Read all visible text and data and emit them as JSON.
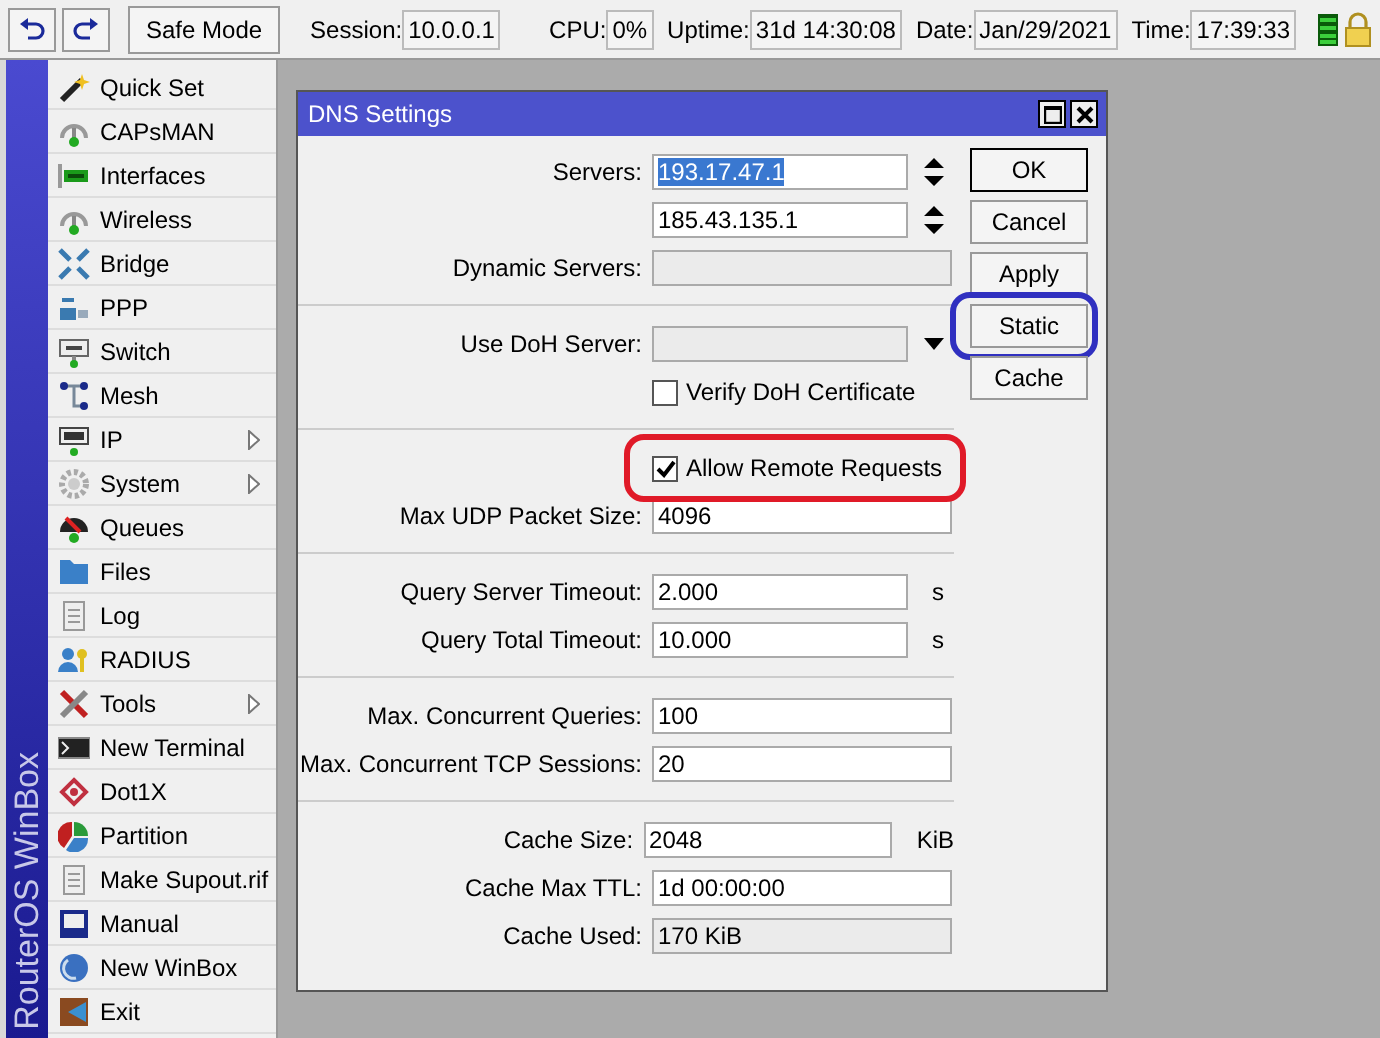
{
  "toolbar": {
    "safe_mode": "Safe Mode",
    "session_label": "Session:",
    "session": "10.0.0.1",
    "status": [
      {
        "label": "CPU:",
        "value": "0%"
      },
      {
        "label": "Uptime:",
        "value": "31d 14:30:08"
      },
      {
        "label": "Date:",
        "value": "Jan/29/2021"
      },
      {
        "label": "Time:",
        "value": "17:39:33"
      }
    ]
  },
  "sidebar": {
    "brand": "RouterOS WinBox",
    "items": [
      {
        "label": "Quick Set",
        "submenu": false
      },
      {
        "label": "CAPsMAN",
        "submenu": false
      },
      {
        "label": "Interfaces",
        "submenu": false
      },
      {
        "label": "Wireless",
        "submenu": false
      },
      {
        "label": "Bridge",
        "submenu": false
      },
      {
        "label": "PPP",
        "submenu": false
      },
      {
        "label": "Switch",
        "submenu": false
      },
      {
        "label": "Mesh",
        "submenu": false
      },
      {
        "label": "IP",
        "submenu": true
      },
      {
        "label": "System",
        "submenu": true
      },
      {
        "label": "Queues",
        "submenu": false
      },
      {
        "label": "Files",
        "submenu": false
      },
      {
        "label": "Log",
        "submenu": false
      },
      {
        "label": "RADIUS",
        "submenu": false
      },
      {
        "label": "Tools",
        "submenu": true
      },
      {
        "label": "New Terminal",
        "submenu": false
      },
      {
        "label": "Dot1X",
        "submenu": false
      },
      {
        "label": "Partition",
        "submenu": false
      },
      {
        "label": "Make Supout.rif",
        "submenu": false
      },
      {
        "label": "Manual",
        "submenu": false
      },
      {
        "label": "New WinBox",
        "submenu": false
      },
      {
        "label": "Exit",
        "submenu": false
      }
    ]
  },
  "dialog": {
    "title": "DNS Settings",
    "rows": [
      {
        "kind": "spinner",
        "label": "Servers:",
        "value": "193.17.47.1",
        "selected": true
      },
      {
        "kind": "spinner",
        "value": "185.43.135.1",
        "selected": false
      },
      {
        "kind": "field",
        "label": "Dynamic Servers:",
        "disabled": true
      },
      {
        "kind": "separator"
      },
      {
        "kind": "dropdown",
        "label": "Use DoH Server:"
      },
      {
        "kind": "checkbox",
        "label": "Verify DoH Certificate",
        "checked": false,
        "circled": false
      },
      {
        "kind": "separator"
      },
      {
        "kind": "checkbox",
        "label": "Allow Remote Requests",
        "checked": true,
        "circled": true
      },
      {
        "kind": "field",
        "label": "Max UDP Packet Size:",
        "value": "4096",
        "disabled": false
      },
      {
        "kind": "separator"
      },
      {
        "kind": "unit-field",
        "label": "Query Server Timeout:",
        "value": "2.000",
        "unit": "s"
      },
      {
        "kind": "unit-field",
        "label": "Query Total Timeout:",
        "value": "10.000",
        "unit": "s"
      },
      {
        "kind": "separator"
      },
      {
        "kind": "field",
        "label": "Max. Concurrent Queries:",
        "value": "100",
        "disabled": false
      },
      {
        "kind": "field",
        "label": "Max. Concurrent TCP Sessions:",
        "value": "20",
        "disabled": false
      },
      {
        "kind": "separator"
      },
      {
        "kind": "unit-field",
        "label": "Cache Size:",
        "value": "2048",
        "unit": "KiB"
      },
      {
        "kind": "field",
        "label": "Cache Max TTL:",
        "value": "1d 00:00:00",
        "disabled": false
      },
      {
        "kind": "field",
        "label": "Cache Used:",
        "value": "170 KiB",
        "disabled": true
      }
    ],
    "buttons": [
      {
        "label": "OK",
        "circled": false
      },
      {
        "label": "Cancel",
        "circled": false
      },
      {
        "label": "Apply",
        "circled": false
      },
      {
        "label": "Static",
        "circled": true
      },
      {
        "label": "Cache",
        "circled": false
      }
    ]
  }
}
